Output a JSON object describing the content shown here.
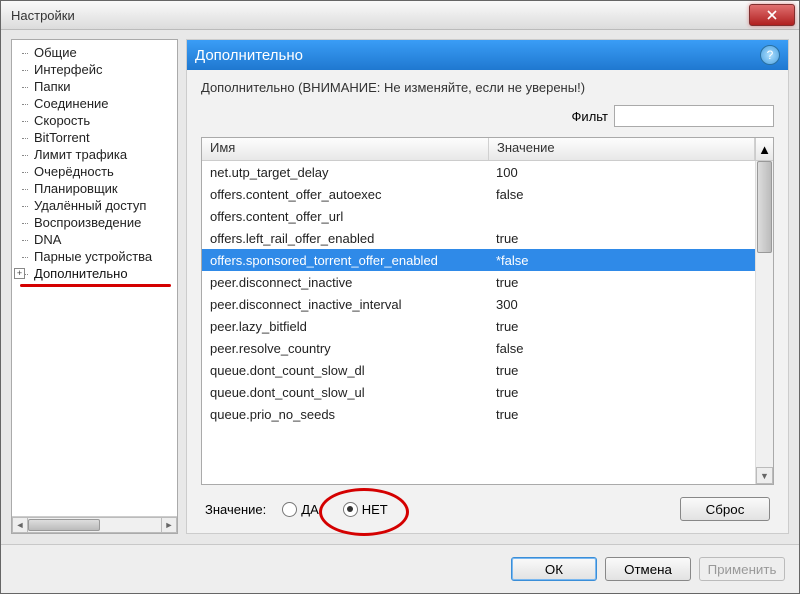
{
  "window": {
    "title": "Настройки"
  },
  "tree": {
    "items": [
      "Общие",
      "Интерфейс",
      "Папки",
      "Соединение",
      "Скорость",
      "BitTorrent",
      "Лимит трафика",
      "Очерёдность",
      "Планировщик",
      "Удалённый доступ",
      "Воспроизведение",
      "DNA",
      "Парные устройства",
      "Дополнительно"
    ],
    "expandable_index": 13
  },
  "panel": {
    "title": "Дополнительно",
    "warning": "Дополнительно (ВНИМАНИЕ: Не изменяйте, если не уверены!)",
    "filter_label": "Фильт",
    "columns": {
      "name": "Имя",
      "value": "Значение"
    },
    "rows": [
      {
        "name": "net.utp_target_delay",
        "value": "100"
      },
      {
        "name": "offers.content_offer_autoexec",
        "value": "false"
      },
      {
        "name": "offers.content_offer_url",
        "value": ""
      },
      {
        "name": "offers.left_rail_offer_enabled",
        "value": "true"
      },
      {
        "name": "offers.sponsored_torrent_offer_enabled",
        "value": "*false",
        "selected": true
      },
      {
        "name": "peer.disconnect_inactive",
        "value": "true"
      },
      {
        "name": "peer.disconnect_inactive_interval",
        "value": "300"
      },
      {
        "name": "peer.lazy_bitfield",
        "value": "true"
      },
      {
        "name": "peer.resolve_country",
        "value": "false"
      },
      {
        "name": "queue.dont_count_slow_dl",
        "value": "true"
      },
      {
        "name": "queue.dont_count_slow_ul",
        "value": "true"
      },
      {
        "name": "queue.prio_no_seeds",
        "value": "true"
      }
    ],
    "value_label": "Значение:",
    "radio_yes": "ДА",
    "radio_no": "НЕТ",
    "radio_selected": "no",
    "reset": "Сброс"
  },
  "buttons": {
    "ok": "ОК",
    "cancel": "Отмена",
    "apply": "Применить"
  }
}
